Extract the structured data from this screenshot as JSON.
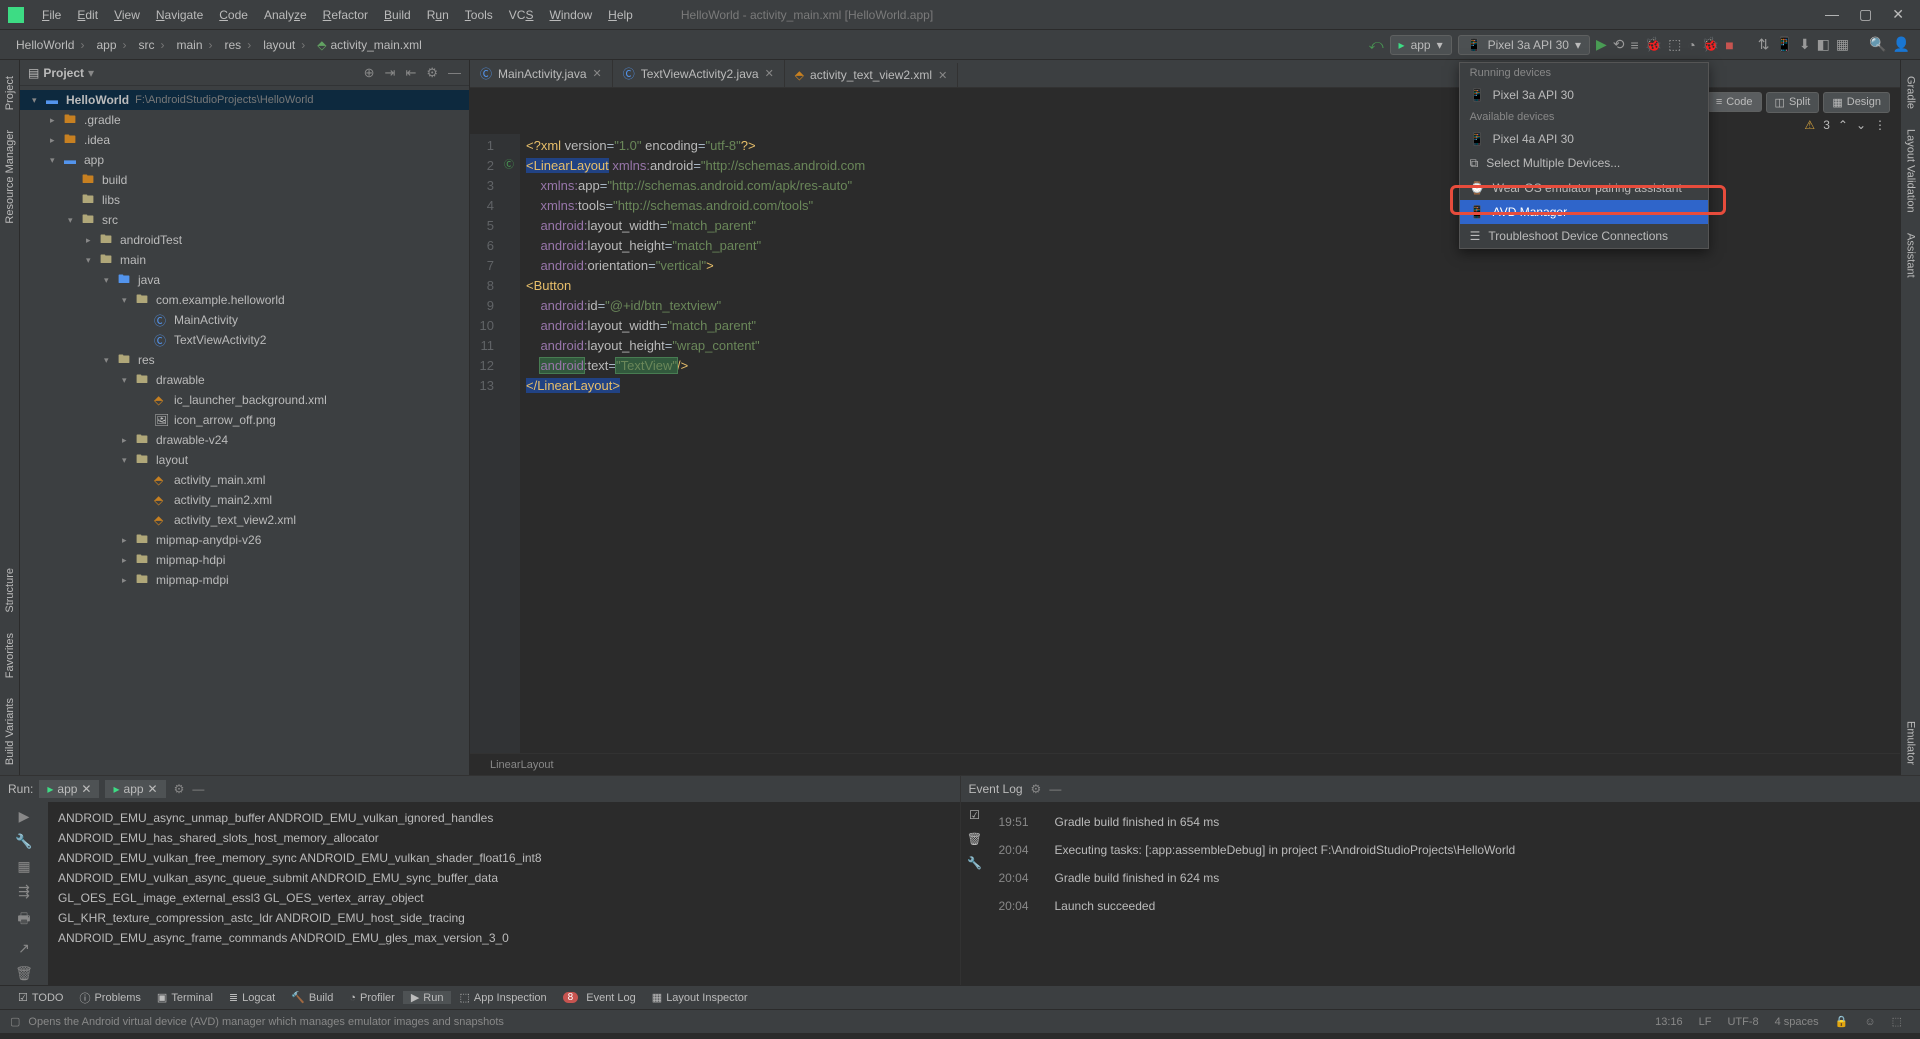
{
  "window_title": "HelloWorld - activity_main.xml [HelloWorld.app]",
  "menu": [
    "File",
    "Edit",
    "View",
    "Navigate",
    "Code",
    "Analyze",
    "Refactor",
    "Build",
    "Run",
    "Tools",
    "VCS",
    "Window",
    "Help"
  ],
  "breadcrumbs": [
    "HelloWorld",
    "app",
    "src",
    "main",
    "res",
    "layout",
    "activity_main.xml"
  ],
  "run_config": {
    "module": "app",
    "device": "Pixel 3a API 30"
  },
  "device_dropdown": {
    "running_header": "Running devices",
    "running": [
      "Pixel 3a API 30"
    ],
    "available_header": "Available devices",
    "available": [
      "Pixel 4a API 30"
    ],
    "actions": [
      "Select Multiple Devices...",
      "Wear OS emulator pairing assistant",
      "AVD Manager",
      "Troubleshoot Device Connections"
    ],
    "highlighted": "AVD Manager"
  },
  "proj_title": "Project",
  "tree": {
    "root": "HelloWorld",
    "root_path": "F:\\AndroidStudioProjects\\HelloWorld",
    "gradle": ".gradle",
    "idea": ".idea",
    "app": "app",
    "build": "build",
    "libs": "libs",
    "src": "src",
    "androidTest": "androidTest",
    "main_f": "main",
    "java": "java",
    "pkg": "com.example.helloworld",
    "MainActivity": "MainActivity",
    "TextViewActivity2": "TextViewActivity2",
    "res": "res",
    "drawable": "drawable",
    "ic_launcher": "ic_launcher_background.xml",
    "icon_arrow": "icon_arrow_off.png",
    "drawable24": "drawable-v24",
    "layout": "layout",
    "act_main": "activity_main.xml",
    "act_main2": "activity_main2.xml",
    "act_tv2": "activity_text_view2.xml",
    "mipmap_any": "mipmap-anydpi-v26",
    "mipmap_hdpi": "mipmap-hdpi",
    "mipmap_mdpi": "mipmap-mdpi"
  },
  "left_tabs": [
    "Project",
    "Resource Manager",
    "Structure",
    "Favorites",
    "Build Variants"
  ],
  "right_tabs": [
    "Gradle",
    "Layout Validation",
    "Assistant",
    "Emulator"
  ],
  "editor_tabs": [
    {
      "label": "MainActivity.java",
      "icon": "javaf"
    },
    {
      "label": "TextViewActivity2.java",
      "icon": "javaf"
    },
    {
      "label": "activity_text_view2.xml",
      "icon": "xmlf"
    }
  ],
  "view_switch": {
    "code": "Code",
    "split": "Split",
    "design": "Design"
  },
  "warnings": "3",
  "code_lines": 13,
  "breadcrumb2": "LinearLayout",
  "run_panel": {
    "title": "Run:",
    "tabs": [
      "app",
      "app"
    ],
    "output": [
      "ANDROID_EMU_async_unmap_buffer ANDROID_EMU_vulkan_ignored_handles",
      "ANDROID_EMU_has_shared_slots_host_memory_allocator",
      "ANDROID_EMU_vulkan_free_memory_sync ANDROID_EMU_vulkan_shader_float16_int8",
      "ANDROID_EMU_vulkan_async_queue_submit ANDROID_EMU_sync_buffer_data",
      "GL_OES_EGL_image_external_essl3 GL_OES_vertex_array_object",
      "GL_KHR_texture_compression_astc_ldr ANDROID_EMU_host_side_tracing",
      "ANDROID_EMU_async_frame_commands ANDROID_EMU_gles_max_version_3_0"
    ]
  },
  "event_log": {
    "title": "Event Log",
    "rows": [
      {
        "ts": "19:51",
        "msg": "Gradle build finished in 654 ms"
      },
      {
        "ts": "20:04",
        "msg": "Executing tasks: [:app:assembleDebug] in project F:\\AndroidStudioProjects\\HelloWorld"
      },
      {
        "ts": "20:04",
        "msg": "Gradle build finished in 624 ms"
      },
      {
        "ts": "20:04",
        "msg": "Launch succeeded"
      }
    ]
  },
  "bottom_tabs": [
    "TODO",
    "Problems",
    "Terminal",
    "Logcat",
    "Build",
    "Profiler",
    "Run",
    "App Inspection"
  ],
  "bottom_right": {
    "event_log": "Event Log",
    "event_count": "8",
    "layout_inspector": "Layout Inspector"
  },
  "status_hint": "Opens the Android virtual device (AVD) manager which manages emulator images and snapshots",
  "status_right": {
    "time": "13:16",
    "le": "LF",
    "enc": "UTF-8",
    "indent": "4 spaces"
  }
}
